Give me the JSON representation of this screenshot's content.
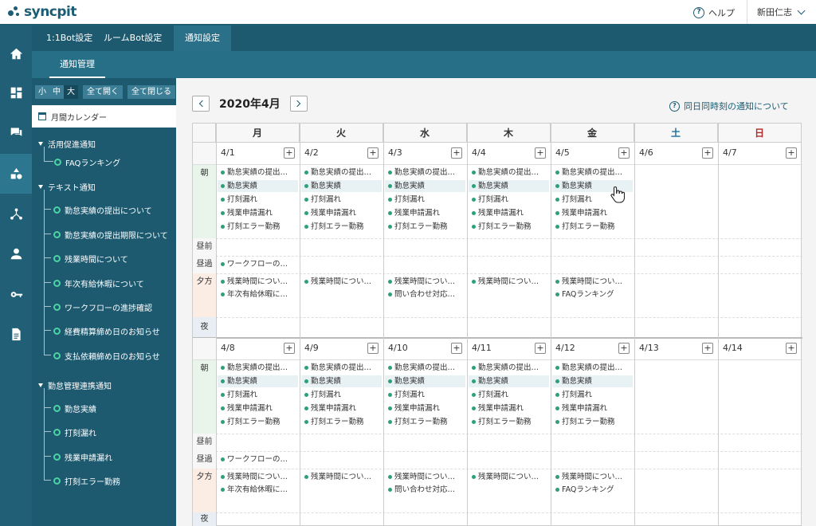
{
  "app": {
    "logo_text": "syncpit",
    "help_label": "ヘルプ",
    "user_name": "新田仁志",
    "accent": "#1c5c74"
  },
  "tabs": [
    {
      "label": "1:1Bot設定"
    },
    {
      "label": "ルームBot設定"
    },
    {
      "label": "通知設定",
      "active": true
    }
  ],
  "subtab": "通知管理",
  "rail_icons": [
    "home-icon",
    "dashboard-icon",
    "chat-icon",
    "shapes-icon",
    "network-icon",
    "user-icon",
    "key-icon",
    "document-icon"
  ],
  "sidebar": {
    "sizes": [
      "小",
      "中",
      "大"
    ],
    "expand_all": "全て開く",
    "collapse_all": "全て閉じる",
    "calendar_item": "月間カレンダー",
    "groups": [
      {
        "label": "活用促進通知",
        "items": [
          "FAQランキング"
        ]
      },
      {
        "label": "テキスト通知",
        "items": [
          "勤怠実績の提出について",
          "勤怠実績の提出期限について",
          "残業時間について",
          "年次有給休暇について",
          "ワークフローの進捗確認",
          "経費精算締め日のお知らせ",
          "支払依頼締め日のお知らせ"
        ]
      },
      {
        "label": "勤怠管理連携通知",
        "items": [
          "勤怠実績",
          "打刻漏れ",
          "残業申請漏れ",
          "打刻エラー勤務"
        ]
      }
    ]
  },
  "calendar": {
    "month_label": "2020年4月",
    "same_time_link": "同日同時刻の通知について",
    "weekdays": [
      "月",
      "火",
      "水",
      "木",
      "金",
      "土",
      "日"
    ],
    "slots": [
      "朝",
      "昼前",
      "昼過",
      "夕方",
      "夜"
    ],
    "weeks": [
      {
        "dates": [
          "4/1",
          "4/2",
          "4/3",
          "4/4",
          "4/5",
          "4/6",
          "4/7"
        ]
      },
      {
        "dates": [
          "4/8",
          "4/9",
          "4/10",
          "4/11",
          "4/12",
          "4/13",
          "4/14"
        ]
      }
    ],
    "morning_events": [
      "勤怠実績の提出…",
      "勤怠実績",
      "打刻漏れ",
      "残業申請漏れ",
      "打刻エラー勤務"
    ],
    "afternoon_event": "ワークフローの…",
    "evening_events": [
      [
        "残業時間につい…",
        "年次有給休暇に…"
      ],
      [
        "残業時間につい…"
      ],
      [
        "残業時間につい…",
        "問い合わせ対応…"
      ],
      [
        "残業時間につい…"
      ],
      [
        "残業時間につい…",
        "FAQランキング"
      ],
      [],
      []
    ]
  }
}
